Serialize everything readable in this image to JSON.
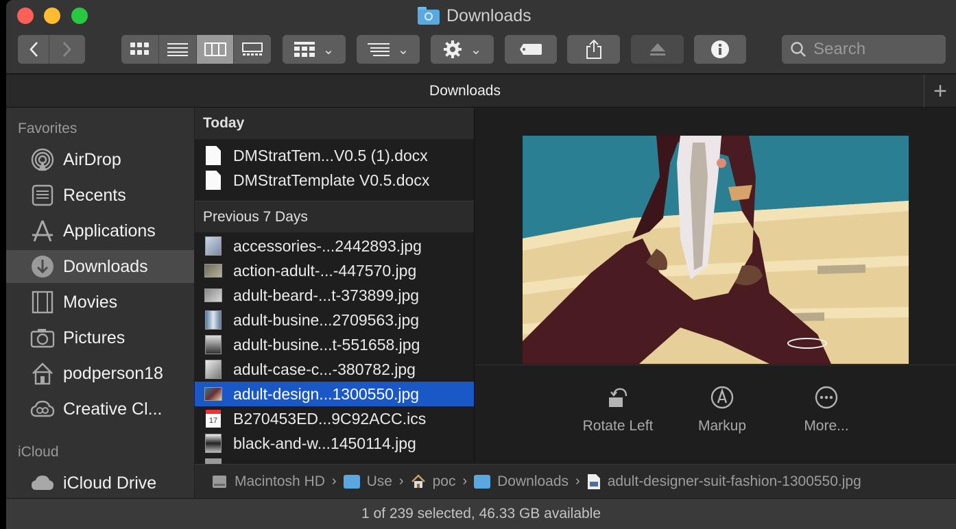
{
  "window": {
    "title": "Downloads"
  },
  "toolbar": {
    "back_icon": "chevron-left-icon",
    "forward_icon": "chevron-right-icon",
    "view_modes": [
      "icon-view",
      "list-view",
      "column-view",
      "gallery-view"
    ],
    "active_view": "column-view",
    "search_placeholder": "Search"
  },
  "tab": {
    "title": "Downloads",
    "add_label": "+"
  },
  "sidebar": {
    "favorites_header": "Favorites",
    "favorites": [
      {
        "label": "AirDrop",
        "icon": "airdrop-icon"
      },
      {
        "label": "Recents",
        "icon": "recents-icon"
      },
      {
        "label": "Applications",
        "icon": "applications-icon"
      },
      {
        "label": "Downloads",
        "icon": "downloads-icon",
        "selected": true
      },
      {
        "label": "Movies",
        "icon": "movies-icon"
      },
      {
        "label": "Pictures",
        "icon": "pictures-icon"
      },
      {
        "label": "podperson18",
        "icon": "home-icon"
      },
      {
        "label": "Creative Cl...",
        "icon": "creative-cloud-icon"
      }
    ],
    "icloud_header": "iCloud",
    "icloud": [
      {
        "label": "iCloud Drive",
        "icon": "cloud-icon"
      }
    ]
  },
  "files": {
    "today_header": "Today",
    "today": [
      "DMStratTem...V0.5 (1).docx",
      "DMStratTemplate V0.5.docx"
    ],
    "prev_header": "Previous 7 Days",
    "previous": [
      "accessories-...2442893.jpg",
      "action-adult-...-447570.jpg",
      "adult-beard-...t-373899.jpg",
      "adult-busine...2709563.jpg",
      "adult-busine...t-551658.jpg",
      "adult-case-c...-380782.jpg",
      "adult-design...1300550.jpg",
      "B270453ED...9C92ACC.ics",
      "black-and-w...1450114.jpg"
    ],
    "selected_index": 6
  },
  "preview": {
    "actions": [
      {
        "label": "Rotate Left",
        "icon": "rotate-left-icon"
      },
      {
        "label": "Markup",
        "icon": "markup-icon"
      },
      {
        "label": "More...",
        "icon": "more-icon"
      }
    ]
  },
  "pathbar": {
    "items": [
      "Macintosh HD",
      "Use",
      "poc",
      "Downloads",
      "adult-designer-suit-fashion-1300550.jpg"
    ],
    "separator": "›"
  },
  "status": {
    "text": "1 of 239 selected, 46.33 GB available"
  },
  "colors": {
    "selection": "#1a58c7",
    "folder": "#5aa8e0",
    "close": "#fe5f57",
    "minimize": "#febc2e",
    "zoom": "#28c840"
  }
}
